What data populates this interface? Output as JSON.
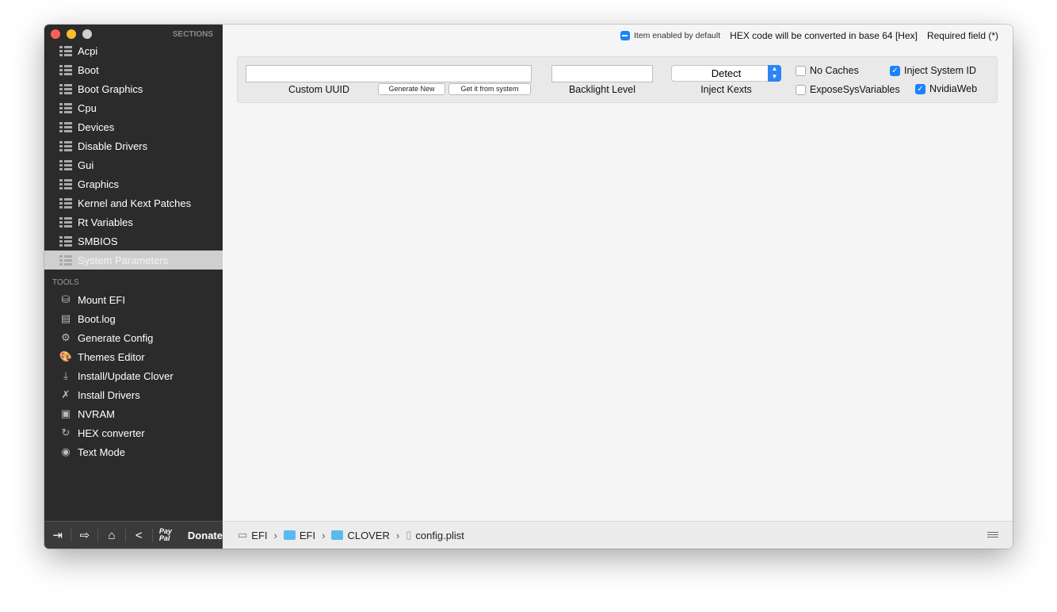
{
  "sidebar": {
    "sections_header": "SECTIONS",
    "sections": [
      "Acpi",
      "Boot",
      "Boot Graphics",
      "Cpu",
      "Devices",
      "Disable Drivers",
      "Gui",
      "Graphics",
      "Kernel and Kext Patches",
      "Rt Variables",
      "SMBIOS",
      "System Parameters"
    ],
    "selected": "System Parameters",
    "tools_header": "TOOLS",
    "tools": [
      {
        "label": "Mount EFI",
        "icon": "disk-icon",
        "glyph": "⛁"
      },
      {
        "label": "Boot.log",
        "icon": "log-icon",
        "glyph": "▤"
      },
      {
        "label": "Generate Config",
        "icon": "gears-icon",
        "glyph": "⚙"
      },
      {
        "label": "Themes Editor",
        "icon": "palette-icon",
        "glyph": "🎨"
      },
      {
        "label": "Install/Update Clover",
        "icon": "download-icon",
        "glyph": "⤓"
      },
      {
        "label": "Install Drivers",
        "icon": "tools-icon",
        "glyph": "✗"
      },
      {
        "label": "NVRAM",
        "icon": "chip-icon",
        "glyph": "▣"
      },
      {
        "label": "HEX converter",
        "icon": "refresh-icon",
        "glyph": "↻"
      },
      {
        "label": "Text Mode",
        "icon": "eye-icon",
        "glyph": "◉"
      }
    ],
    "bottom": {
      "paypal": "Pay Pal",
      "donate": "Donate"
    }
  },
  "header": {
    "enabled_default": "Item enabled by default",
    "hex_note": "HEX code will be converted in base 64 [Hex]",
    "required": "Required field (*)"
  },
  "panel": {
    "custom_uuid_value": "",
    "custom_uuid_label": "Custom UUID",
    "generate_new": "Generate New",
    "get_from_system": "Get it from system",
    "backlight_value": "",
    "backlight_label": "Backlight Level",
    "inject_kexts_value": "Detect",
    "inject_kexts_label": "Inject Kexts",
    "no_caches": {
      "label": "No Caches",
      "checked": false
    },
    "inject_system_id": {
      "label": "Inject System ID",
      "checked": true
    },
    "expose_sys_variables": {
      "label": "ExposeSysVariables",
      "checked": false
    },
    "nvidia_web": {
      "label": "NvidiaWeb",
      "checked": true
    }
  },
  "footer": {
    "path": [
      "EFI",
      "EFI",
      "CLOVER",
      "config.plist"
    ]
  },
  "colors": {
    "accent": "#1a82fb",
    "sidebar": "#2b2b2b"
  }
}
